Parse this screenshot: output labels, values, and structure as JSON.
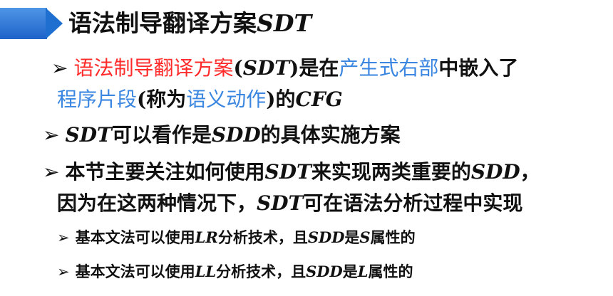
{
  "title": {
    "prefix": "语法制导翻译方案",
    "suffix": "SDT"
  },
  "bullet_symbol": "➢",
  "b1": {
    "red": "语法制导翻译方案",
    "paren_open": "(",
    "sdt": "SDT",
    "p1": ")是在",
    "blue1": "产生式右部",
    "p2": "中嵌入了",
    "blue2": "程序片段",
    "p3": "(称为",
    "blue3": "语义动作",
    "p4": ")的",
    "cfg": "CFG"
  },
  "b2": {
    "sdt": "SDT",
    "p1": "可以看作是",
    "sdd": "SDD",
    "p2": "的具体实施方案"
  },
  "b3": {
    "p1": "本节主要关注如何使用",
    "sdt": "SDT",
    "p2": "来实现两类重要的",
    "sdd": "SDD",
    "p3": "，",
    "line2_p1": "因为在这两种情况下，",
    "line2_sdt": "SDT",
    "line2_p2": "可在语法分析过程中实现"
  },
  "s1": {
    "p1": "基本文法可以使用",
    "lr": "LR",
    "p2": "分析技术，且",
    "sdd": "SDD",
    "p3": "是",
    "attr": "S",
    "p4": "属性的"
  },
  "s2": {
    "p1": "基本文法可以使用",
    "ll": "LL",
    "p2": "分析技术，且",
    "sdd": "SDD",
    "p3": "是",
    "attr": "L",
    "p4": "属性的"
  }
}
